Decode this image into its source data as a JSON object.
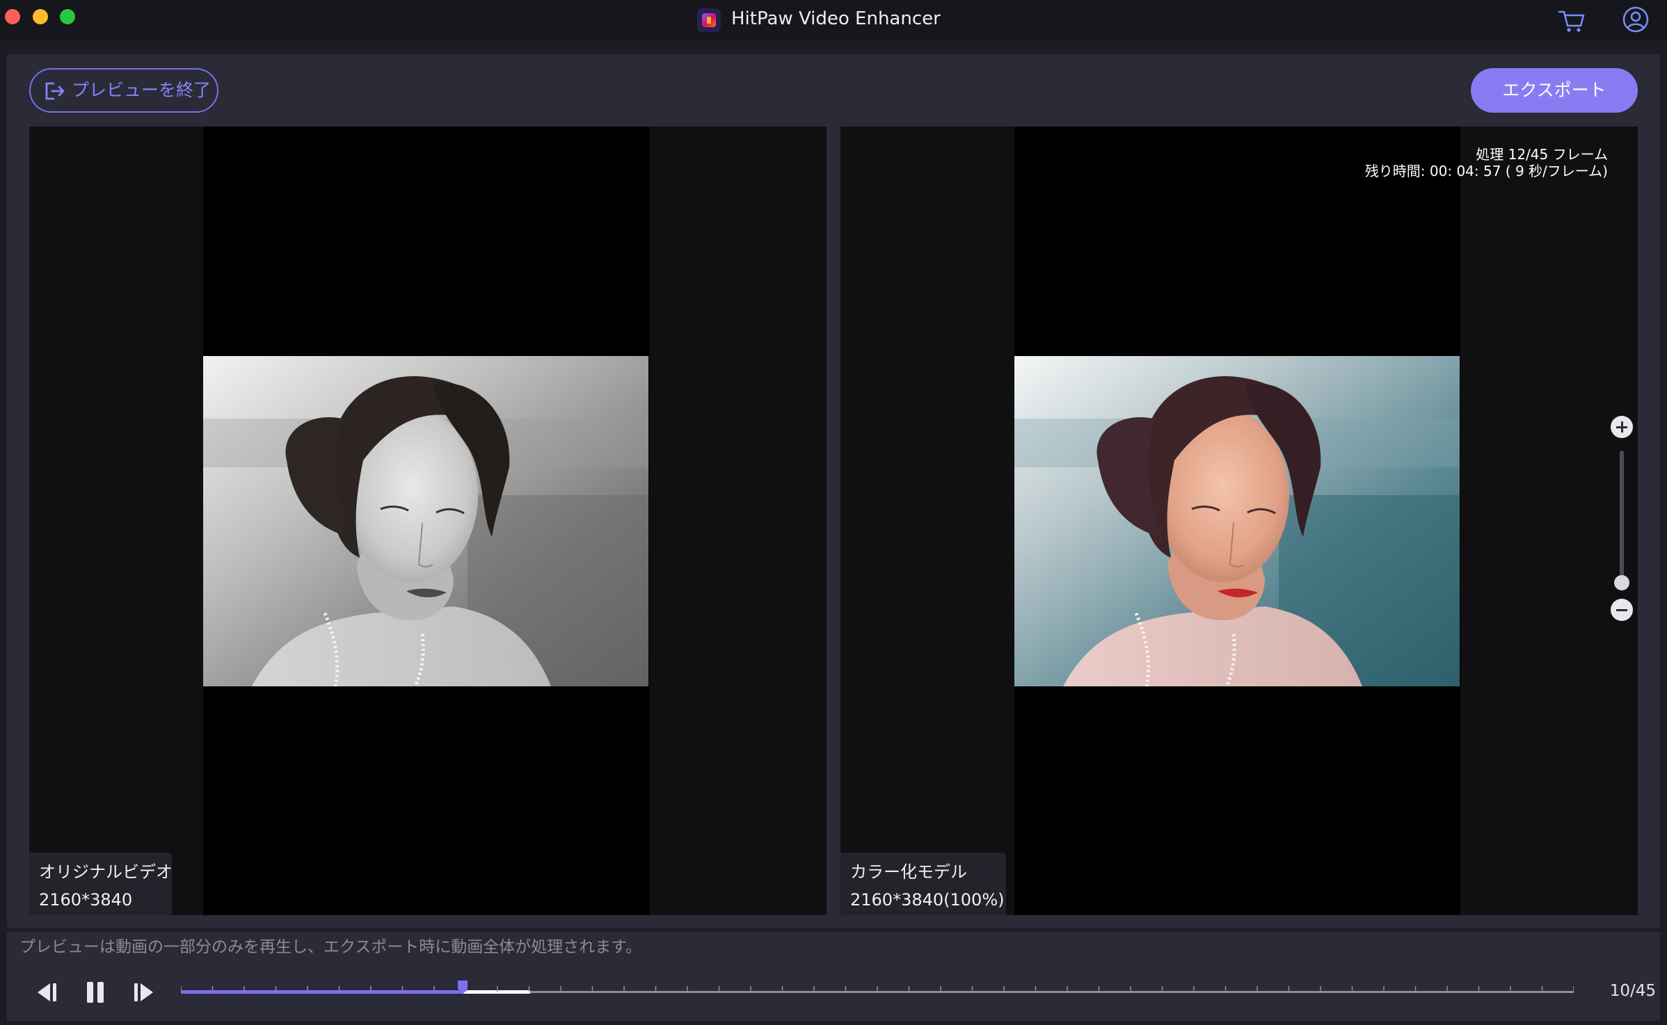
{
  "window": {
    "title": "HitPaw Video Enhancer",
    "icons": [
      "app-logo",
      "cart-icon",
      "account-icon"
    ]
  },
  "toolbar": {
    "exit_preview_label": "プレビューを終了",
    "export_label": "エクスポート"
  },
  "panes": {
    "original": {
      "name": "オリジナルビデオ",
      "resolution": "2160*3840"
    },
    "result": {
      "name": "カラー化モデル",
      "resolution": "2160*3840(100%)"
    }
  },
  "processing": {
    "frames_text": "処理 12/45 フレーム",
    "remaining_text": "残り時間: 00: 04: 57 ( 9 秒/フレーム)"
  },
  "zoom": {
    "level_fraction": 0.0
  },
  "footer": {
    "hint": "プレビューは動画の一部分のみを再生し、エクスポート時に動画全体が処理されます。",
    "frame_counter": "10/45",
    "current_frame": 10,
    "processed_frames": 12,
    "total_frames": 45,
    "tick_count": 45
  },
  "colors": {
    "accent": "#8b7bf2",
    "accent_text": "#8d80ff",
    "panel_bg": "#2a2b36",
    "window_bg": "#1c1d24",
    "played": "#7d6ff0",
    "buffered": "#ffffff"
  }
}
